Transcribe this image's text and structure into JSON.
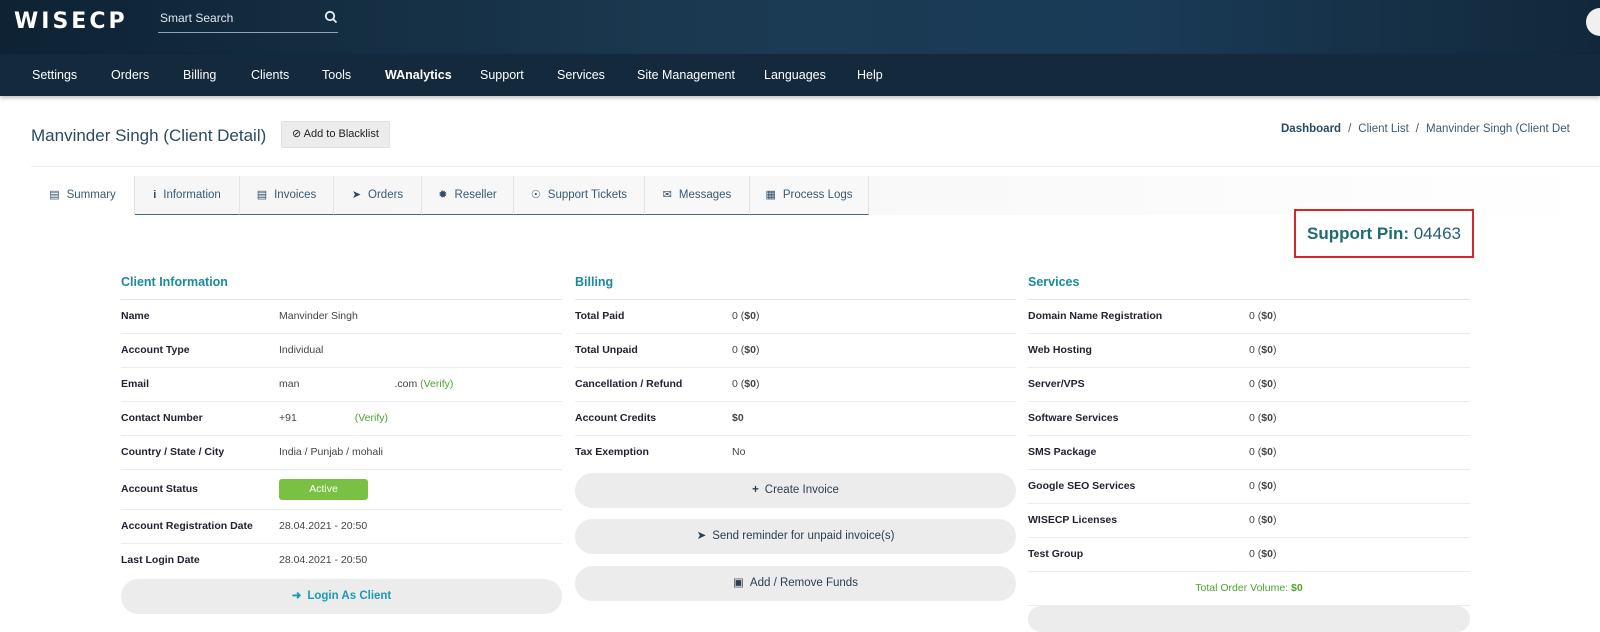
{
  "header": {
    "logo": "WISECP",
    "search_placeholder": "Smart Search"
  },
  "nav": [
    "Settings",
    "Orders",
    "Billing",
    "Clients",
    "Tools",
    "WAnalytics",
    "Support",
    "Services",
    "Site Management",
    "Languages",
    "Help"
  ],
  "page": {
    "title": "Manvinder Singh (Client Detail)",
    "blacklist_label": "Add to Blacklist",
    "breadcrumb": [
      "Dashboard",
      "Client List",
      "Manvinder Singh (Client Det"
    ]
  },
  "tabs": [
    "Summary",
    "Information",
    "Invoices",
    "Orders",
    "Reseller",
    "Support Tickets",
    "Messages",
    "Process Logs"
  ],
  "support_pin": {
    "label": "Support Pin:",
    "value": "04463"
  },
  "client_info": {
    "title": "Client Information",
    "name_label": "Name",
    "name": "Manvinder Singh",
    "type_label": "Account Type",
    "type": "Individual",
    "email_label": "Email",
    "email_start": "man",
    "email_end": ".com",
    "verify": "(Verify)",
    "phone_label": "Contact Number",
    "phone_start": "+91",
    "location_label": "Country / State / City",
    "location": "India / Punjab / mohali",
    "status_label": "Account Status",
    "status": "Active",
    "reg_label": "Account Registration Date",
    "reg_date": "28.04.2021 - 20:50",
    "login_label": "Last Login Date",
    "login_date": "28.04.2021 - 20:50",
    "login_as_client": "Login As Client"
  },
  "billing": {
    "title": "Billing",
    "paid_label": "Total Paid",
    "paid": "0",
    "paid_amt": "$0",
    "unpaid_label": "Total Unpaid",
    "unpaid": "0",
    "unpaid_amt": "$0",
    "refund_label": "Cancellation / Refund",
    "refund": "0",
    "refund_amt": "$0",
    "credits_label": "Account Credits",
    "credits": "$0",
    "tax_label": "Tax Exemption",
    "tax": "No",
    "create_invoice": "Create Invoice",
    "send_reminder": "Send reminder for unpaid invoice(s)",
    "funds": "Add / Remove Funds"
  },
  "services": {
    "title": "Services",
    "items": [
      {
        "label": "Domain Name Registration",
        "count": "0",
        "amt": "$0"
      },
      {
        "label": "Web Hosting",
        "count": "0",
        "amt": "$0"
      },
      {
        "label": "Server/VPS",
        "count": "0",
        "amt": "$0"
      },
      {
        "label": "Software Services",
        "count": "0",
        "amt": "$0"
      },
      {
        "label": "SMS Package",
        "count": "0",
        "amt": "$0"
      },
      {
        "label": "Google SEO Services",
        "count": "0",
        "amt": "$0"
      },
      {
        "label": "WISECP Licenses",
        "count": "0",
        "amt": "$0"
      },
      {
        "label": "Test Group",
        "count": "0",
        "amt": "$0"
      }
    ],
    "total_label": "Total Order Volume:",
    "total": "$0"
  },
  "colors": {
    "accent": "#1a8b9d",
    "nav": "#14293b",
    "active_badge": "#7ac143",
    "pin_border": "#d62828"
  }
}
